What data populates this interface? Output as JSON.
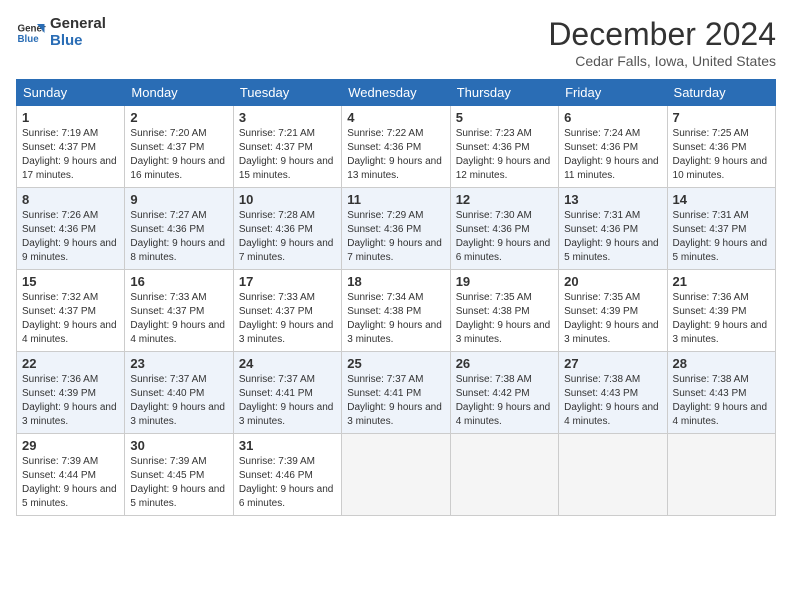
{
  "header": {
    "logo_line1": "General",
    "logo_line2": "Blue",
    "month": "December 2024",
    "location": "Cedar Falls, Iowa, United States"
  },
  "weekdays": [
    "Sunday",
    "Monday",
    "Tuesday",
    "Wednesday",
    "Thursday",
    "Friday",
    "Saturday"
  ],
  "weeks": [
    [
      {
        "day": "1",
        "sunrise": "7:19 AM",
        "sunset": "4:37 PM",
        "daylight": "9 hours and 17 minutes."
      },
      {
        "day": "2",
        "sunrise": "7:20 AM",
        "sunset": "4:37 PM",
        "daylight": "9 hours and 16 minutes."
      },
      {
        "day": "3",
        "sunrise": "7:21 AM",
        "sunset": "4:37 PM",
        "daylight": "9 hours and 15 minutes."
      },
      {
        "day": "4",
        "sunrise": "7:22 AM",
        "sunset": "4:36 PM",
        "daylight": "9 hours and 13 minutes."
      },
      {
        "day": "5",
        "sunrise": "7:23 AM",
        "sunset": "4:36 PM",
        "daylight": "9 hours and 12 minutes."
      },
      {
        "day": "6",
        "sunrise": "7:24 AM",
        "sunset": "4:36 PM",
        "daylight": "9 hours and 11 minutes."
      },
      {
        "day": "7",
        "sunrise": "7:25 AM",
        "sunset": "4:36 PM",
        "daylight": "9 hours and 10 minutes."
      }
    ],
    [
      {
        "day": "8",
        "sunrise": "7:26 AM",
        "sunset": "4:36 PM",
        "daylight": "9 hours and 9 minutes."
      },
      {
        "day": "9",
        "sunrise": "7:27 AM",
        "sunset": "4:36 PM",
        "daylight": "9 hours and 8 minutes."
      },
      {
        "day": "10",
        "sunrise": "7:28 AM",
        "sunset": "4:36 PM",
        "daylight": "9 hours and 7 minutes."
      },
      {
        "day": "11",
        "sunrise": "7:29 AM",
        "sunset": "4:36 PM",
        "daylight": "9 hours and 7 minutes."
      },
      {
        "day": "12",
        "sunrise": "7:30 AM",
        "sunset": "4:36 PM",
        "daylight": "9 hours and 6 minutes."
      },
      {
        "day": "13",
        "sunrise": "7:31 AM",
        "sunset": "4:36 PM",
        "daylight": "9 hours and 5 minutes."
      },
      {
        "day": "14",
        "sunrise": "7:31 AM",
        "sunset": "4:37 PM",
        "daylight": "9 hours and 5 minutes."
      }
    ],
    [
      {
        "day": "15",
        "sunrise": "7:32 AM",
        "sunset": "4:37 PM",
        "daylight": "9 hours and 4 minutes."
      },
      {
        "day": "16",
        "sunrise": "7:33 AM",
        "sunset": "4:37 PM",
        "daylight": "9 hours and 4 minutes."
      },
      {
        "day": "17",
        "sunrise": "7:33 AM",
        "sunset": "4:37 PM",
        "daylight": "9 hours and 3 minutes."
      },
      {
        "day": "18",
        "sunrise": "7:34 AM",
        "sunset": "4:38 PM",
        "daylight": "9 hours and 3 minutes."
      },
      {
        "day": "19",
        "sunrise": "7:35 AM",
        "sunset": "4:38 PM",
        "daylight": "9 hours and 3 minutes."
      },
      {
        "day": "20",
        "sunrise": "7:35 AM",
        "sunset": "4:39 PM",
        "daylight": "9 hours and 3 minutes."
      },
      {
        "day": "21",
        "sunrise": "7:36 AM",
        "sunset": "4:39 PM",
        "daylight": "9 hours and 3 minutes."
      }
    ],
    [
      {
        "day": "22",
        "sunrise": "7:36 AM",
        "sunset": "4:39 PM",
        "daylight": "9 hours and 3 minutes."
      },
      {
        "day": "23",
        "sunrise": "7:37 AM",
        "sunset": "4:40 PM",
        "daylight": "9 hours and 3 minutes."
      },
      {
        "day": "24",
        "sunrise": "7:37 AM",
        "sunset": "4:41 PM",
        "daylight": "9 hours and 3 minutes."
      },
      {
        "day": "25",
        "sunrise": "7:37 AM",
        "sunset": "4:41 PM",
        "daylight": "9 hours and 3 minutes."
      },
      {
        "day": "26",
        "sunrise": "7:38 AM",
        "sunset": "4:42 PM",
        "daylight": "9 hours and 4 minutes."
      },
      {
        "day": "27",
        "sunrise": "7:38 AM",
        "sunset": "4:43 PM",
        "daylight": "9 hours and 4 minutes."
      },
      {
        "day": "28",
        "sunrise": "7:38 AM",
        "sunset": "4:43 PM",
        "daylight": "9 hours and 4 minutes."
      }
    ],
    [
      {
        "day": "29",
        "sunrise": "7:39 AM",
        "sunset": "4:44 PM",
        "daylight": "9 hours and 5 minutes."
      },
      {
        "day": "30",
        "sunrise": "7:39 AM",
        "sunset": "4:45 PM",
        "daylight": "9 hours and 5 minutes."
      },
      {
        "day": "31",
        "sunrise": "7:39 AM",
        "sunset": "4:46 PM",
        "daylight": "9 hours and 6 minutes."
      },
      null,
      null,
      null,
      null
    ]
  ],
  "labels": {
    "sunrise": "Sunrise:",
    "sunset": "Sunset:",
    "daylight": "Daylight:"
  }
}
